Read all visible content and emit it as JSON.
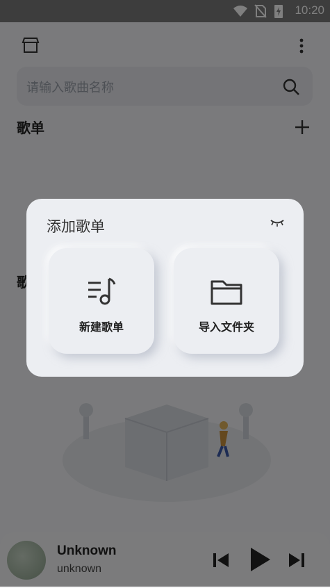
{
  "status_bar": {
    "time": "10:20"
  },
  "search": {
    "placeholder": "请输入歌曲名称"
  },
  "sections": {
    "playlist_title": "歌单",
    "second_title_partial": "歌"
  },
  "mini_player": {
    "title": "Unknown",
    "artist": "unknown"
  },
  "modal": {
    "title": "添加歌单",
    "cards": [
      {
        "label": "新建歌单",
        "icon": "music-playlist-icon"
      },
      {
        "label": "导入文件夹",
        "icon": "folder-icon"
      }
    ]
  },
  "colors": {
    "scrim": "#000000",
    "modal_bg": "#eceef2",
    "accent": "#222222"
  }
}
